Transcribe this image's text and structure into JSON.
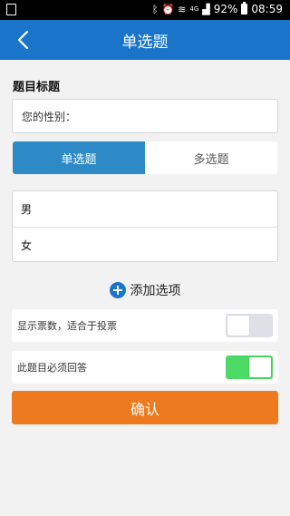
{
  "status_bar": {
    "battery": "92%",
    "time": "08:59",
    "network": "4G"
  },
  "app_bar": {
    "title": "单选题"
  },
  "form": {
    "title_label": "题目标题",
    "title_value": "您的性别："
  },
  "question_types": [
    {
      "label": "单选题",
      "active": true
    },
    {
      "label": "多选题",
      "active": false
    }
  ],
  "options": [
    "男",
    "女"
  ],
  "add_option_label": "添加选项",
  "settings": [
    {
      "label": "显示票数，适合于投票",
      "enabled": false
    },
    {
      "label": "此题目必须回答",
      "enabled": true
    }
  ],
  "confirm_label": "确认",
  "colors": {
    "primary": "#1a74c9",
    "tab_active": "#2d8ac7",
    "confirm": "#ee7a1f",
    "toggle_on": "#4cd964"
  },
  "icons": [
    "back-arrow-icon",
    "add-icon"
  ]
}
